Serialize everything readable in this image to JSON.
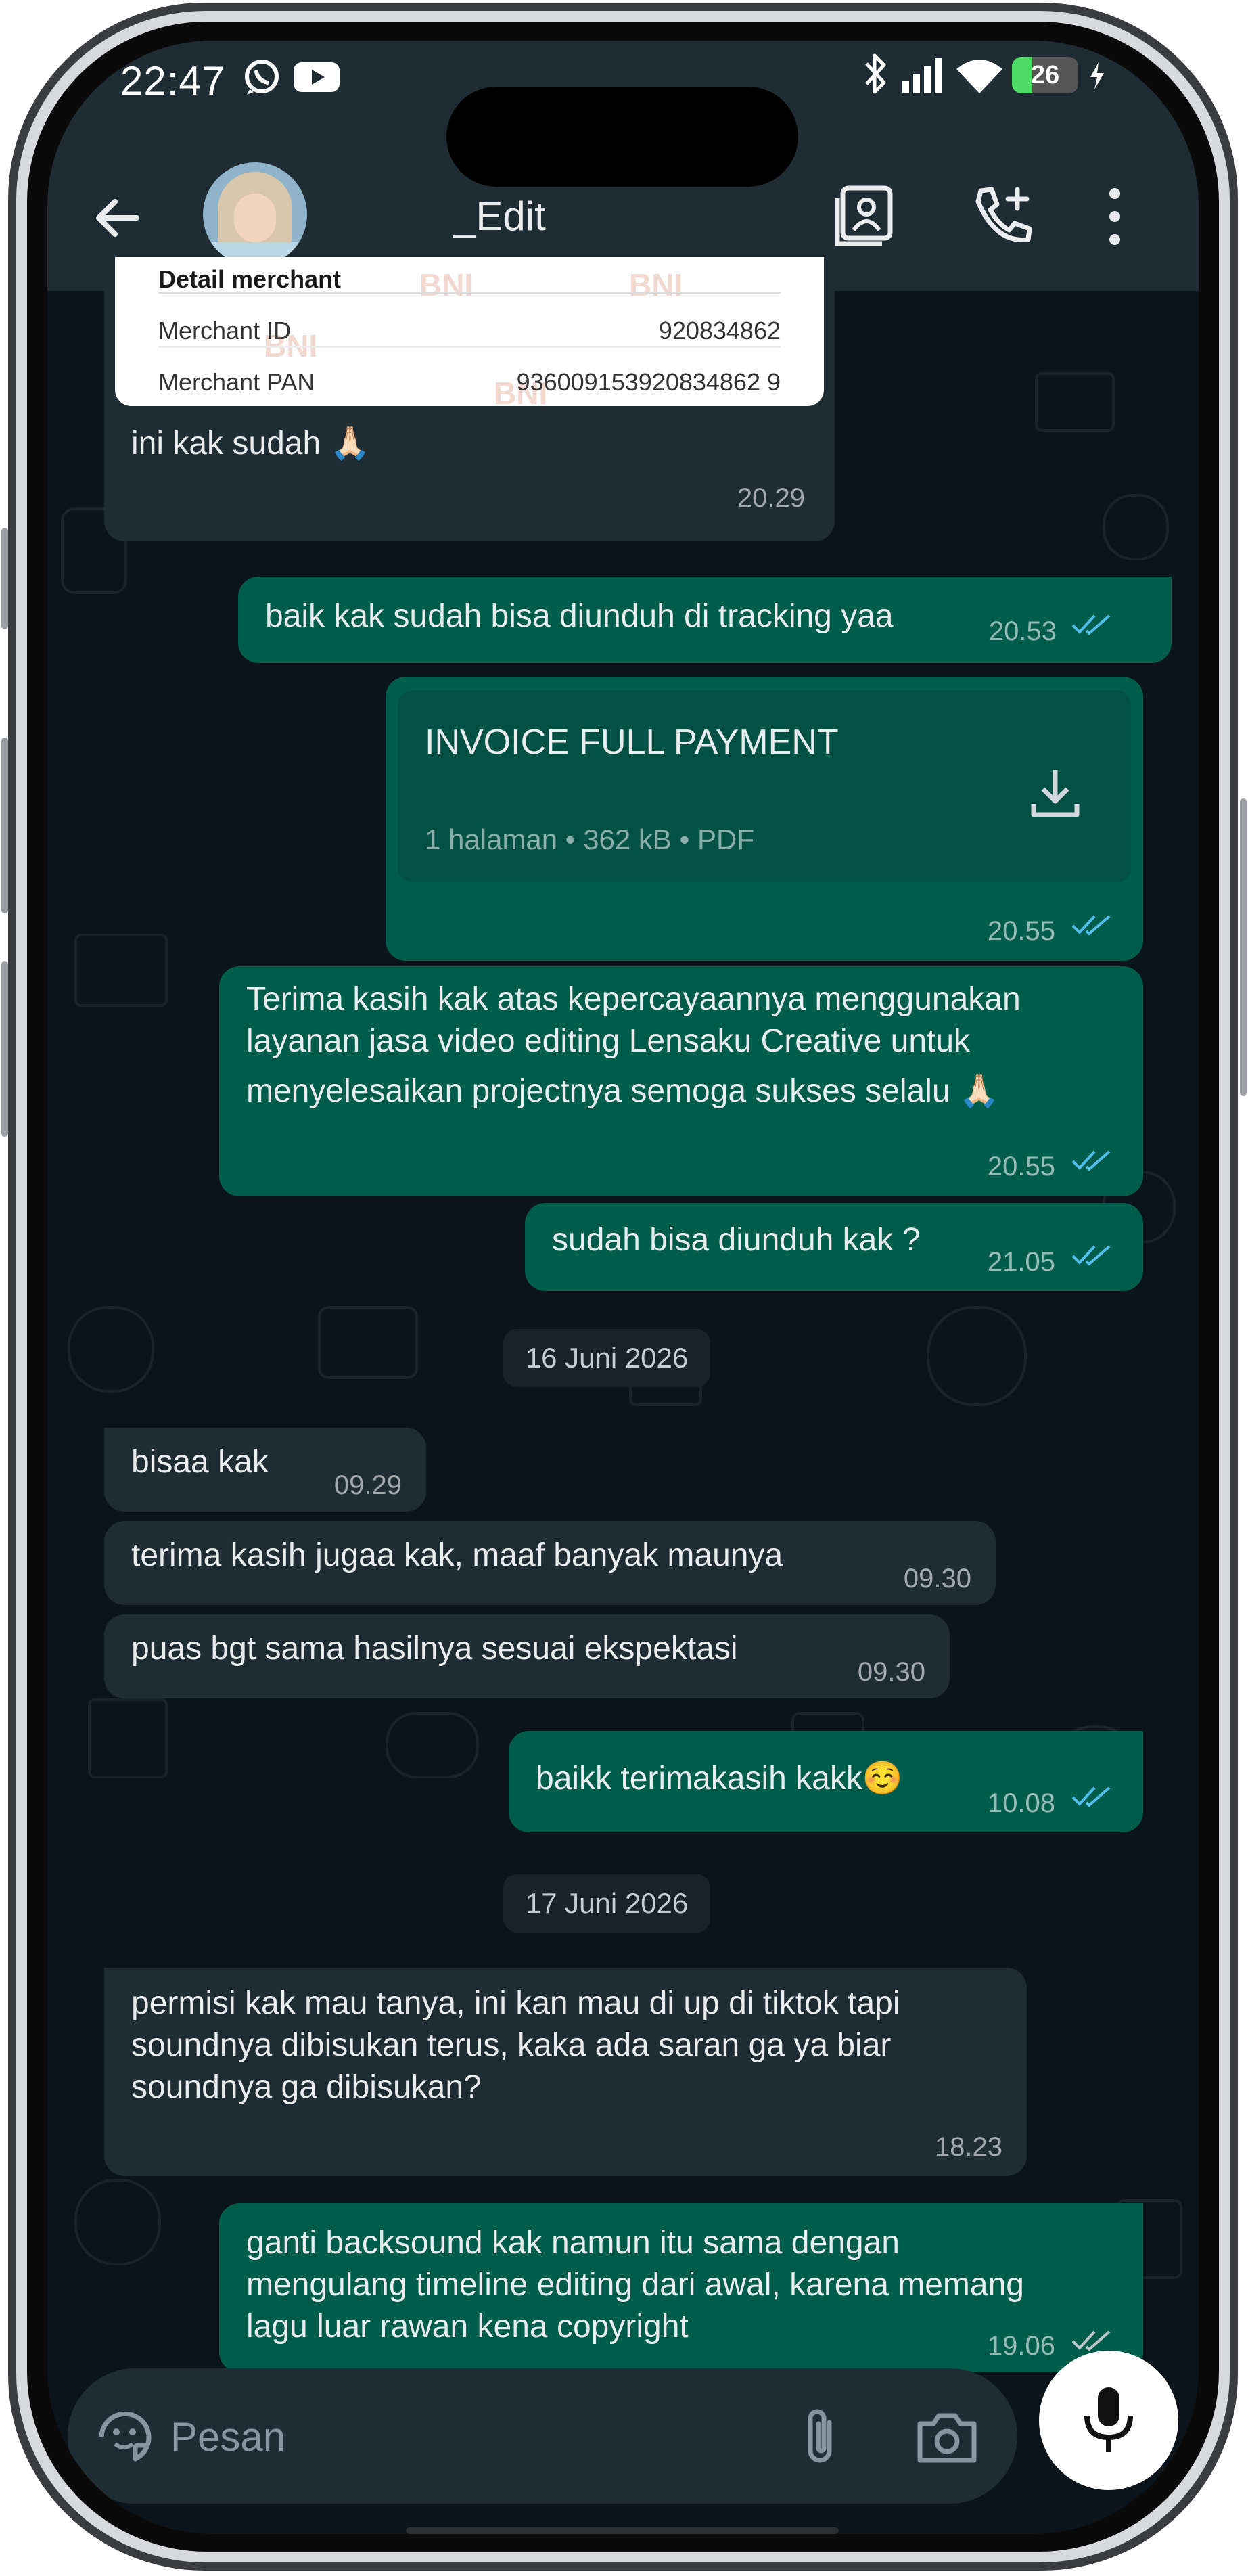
{
  "status_bar": {
    "time": "22:47",
    "battery": "26"
  },
  "header": {
    "contact_name": "_Edit"
  },
  "receipt": {
    "section_title": "Detail merchant",
    "rows": [
      {
        "label": "Merchant ID",
        "value": "920834862"
      },
      {
        "label": "Merchant PAN",
        "value": "936009153920834862 9"
      }
    ],
    "watermark": "BNI"
  },
  "messages": [
    {
      "dir": "in",
      "text": "ini kak sudah 🙏🏻",
      "time": "20.29"
    },
    {
      "dir": "out",
      "text": "baik kak sudah bisa diunduh di tracking yaa",
      "time": "20.53"
    },
    {
      "dir": "out",
      "document": {
        "name": "INVOICE FULL PAYMENT",
        "meta": "1 halaman • 362 kB • PDF"
      },
      "time": "20.55"
    },
    {
      "dir": "out",
      "lines": [
        "Terima kasih kak atas kepercayaannya menggunakan",
        "layanan jasa video editing Lensaku Creative untuk",
        "menyelesaikan projectnya semoga sukses selalu 🙏🏻"
      ],
      "time": "20.55"
    },
    {
      "dir": "out",
      "text": "sudah bisa diunduh kak ?",
      "time": "21.05"
    },
    {
      "date": "16 Juni 2026"
    },
    {
      "dir": "in",
      "text": "bisaa kak",
      "time": "09.29"
    },
    {
      "dir": "in",
      "text": "terima kasih jugaa kak, maaf banyak maunya",
      "time": "09.30"
    },
    {
      "dir": "in",
      "text": "puas bgt sama hasilnya sesuai ekspektasi",
      "time": "09.30"
    },
    {
      "dir": "out",
      "text": "baikk terimakasih kakk☺️",
      "time": "10.08"
    },
    {
      "date": "17 Juni 2026"
    },
    {
      "dir": "in",
      "lines": [
        "permisi kak mau tanya, ini kan mau di up di tiktok tapi",
        "soundnya dibisukan terus, kaka ada saran ga ya biar",
        "soundnya ga dibisukan?"
      ],
      "time": "18.23"
    },
    {
      "dir": "out",
      "lines": [
        "ganti backsound kak namun itu sama dengan",
        "mengulang timeline editing dari awal, karena memang",
        "lagu luar rawan kena copyright"
      ],
      "time": "19.06"
    }
  ],
  "composer": {
    "placeholder": "Pesan"
  },
  "colors": {
    "header_bg": "#1f2c33",
    "chat_bg": "#0b141a",
    "incoming_bubble": "#1f2c33",
    "outgoing_bubble": "#005c4b",
    "read_ticks": "#53bdeb",
    "battery_green": "#4cd964"
  },
  "icons": [
    "whatsapp-icon",
    "youtube-icon",
    "bluetooth-icon",
    "signal-icon",
    "wifi-icon",
    "battery-icon",
    "charging-icon",
    "back-arrow-icon",
    "contact-card-icon",
    "add-call-icon",
    "more-vert-icon",
    "download-icon",
    "sticker-icon",
    "attach-icon",
    "camera-icon",
    "mic-icon"
  ]
}
